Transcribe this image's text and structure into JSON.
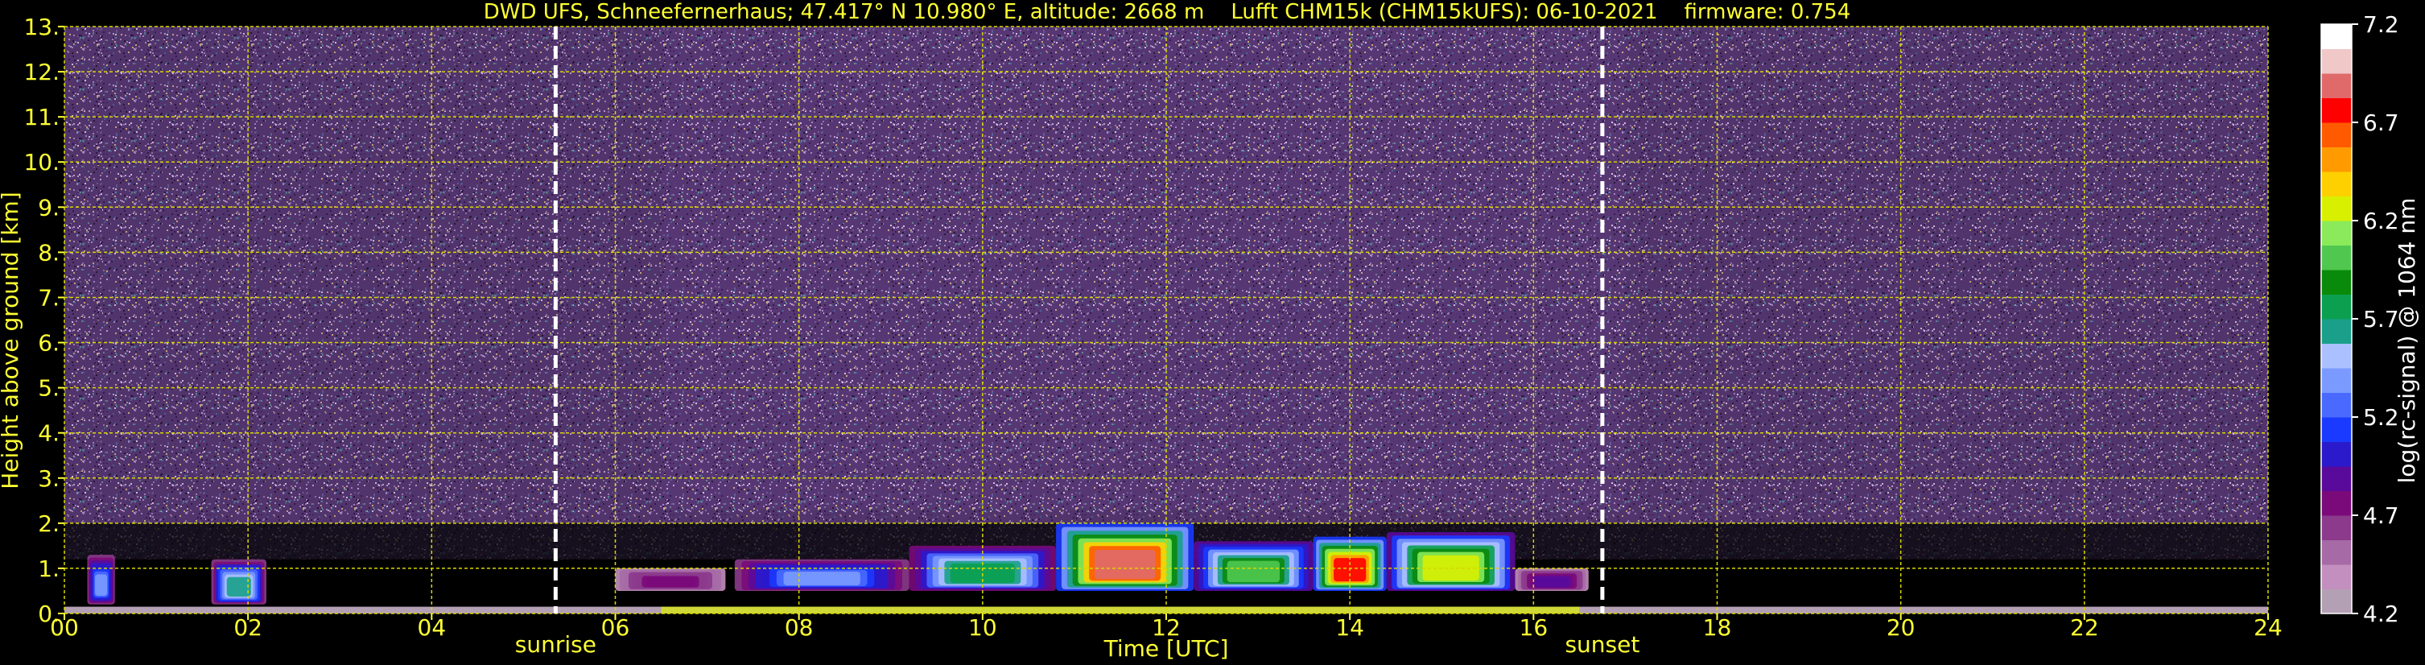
{
  "chart_data": {
    "type": "heatmap",
    "title": "DWD UFS, Schneefernerhaus; 47.417° N 10.980° E, altitude: 2668 m    Lufft CHM15k (CHM15kUFS): 06-10-2021    firmware: 0.754",
    "xlabel": "Time [UTC]",
    "ylabel": "Height above ground [km]",
    "colorbar_label": "log(rc-signal) @ 1064 nm",
    "xlim": [
      0,
      24
    ],
    "ylim": [
      0,
      13
    ],
    "x_ticks": [
      "00",
      "02",
      "04",
      "06",
      "08",
      "10",
      "12",
      "14",
      "16",
      "18",
      "20",
      "22",
      "24"
    ],
    "x_tick_values": [
      0,
      2,
      4,
      6,
      8,
      10,
      12,
      14,
      16,
      18,
      20,
      22,
      24
    ],
    "y_ticks": [
      "0.",
      "1.",
      "2.",
      "3.",
      "4.",
      "5.",
      "6.",
      "7.",
      "8.",
      "9.",
      "10.",
      "11.",
      "12.",
      "13."
    ],
    "y_tick_values": [
      0,
      1,
      2,
      3,
      4,
      5,
      6,
      7,
      8,
      9,
      10,
      11,
      12,
      13
    ],
    "colorbar_range": [
      4.2,
      7.2
    ],
    "colorbar_ticks": [
      "4.2",
      "4.7",
      "5.2",
      "5.7",
      "6.2",
      "6.7",
      "7.2"
    ],
    "colorbar_tick_values": [
      4.2,
      4.7,
      5.2,
      5.7,
      6.2,
      6.7,
      7.2
    ],
    "events": [
      {
        "label": "sunrise",
        "time": 5.35
      },
      {
        "label": "sunset",
        "time": 16.75
      }
    ],
    "grid": true,
    "cloud_layers": [
      {
        "start": 0.25,
        "end": 0.55,
        "bottom": 0.2,
        "top": 1.3,
        "max_signal": 5.4
      },
      {
        "start": 1.6,
        "end": 2.2,
        "bottom": 0.2,
        "top": 1.2,
        "max_signal": 5.6
      },
      {
        "start": 6.0,
        "end": 7.2,
        "bottom": 0.5,
        "top": 1.0,
        "max_signal": 4.8
      },
      {
        "start": 7.3,
        "end": 9.2,
        "bottom": 0.5,
        "top": 1.2,
        "max_signal": 5.4
      },
      {
        "start": 9.2,
        "end": 10.8,
        "bottom": 0.5,
        "top": 1.5,
        "max_signal": 5.8
      },
      {
        "start": 10.8,
        "end": 12.3,
        "bottom": 0.5,
        "top": 2.0,
        "max_signal": 6.9
      },
      {
        "start": 12.3,
        "end": 13.6,
        "bottom": 0.5,
        "top": 1.6,
        "max_signal": 6.0
      },
      {
        "start": 13.6,
        "end": 14.4,
        "bottom": 0.5,
        "top": 1.7,
        "max_signal": 6.8
      },
      {
        "start": 14.4,
        "end": 15.8,
        "bottom": 0.5,
        "top": 1.8,
        "max_signal": 6.3
      },
      {
        "start": 15.8,
        "end": 16.6,
        "bottom": 0.5,
        "top": 1.0,
        "max_signal": 4.9
      }
    ],
    "colors": {
      "title": "#ffff33",
      "axis_text": "#ffff33",
      "grid": "#d8d800",
      "event_line": "#ffffff",
      "colorbar_text": "#ffffff",
      "background": "#000000",
      "colormap": [
        "#b4a0b4",
        "#c38fbf",
        "#a66aa6",
        "#8c3a8c",
        "#7a0a7a",
        "#5a0a9a",
        "#2a1acc",
        "#1a3aff",
        "#4a6aff",
        "#7a9aff",
        "#aac0ff",
        "#1aa08a",
        "#0aa050",
        "#0a8a0a",
        "#50c850",
        "#8aea5a",
        "#d8f000",
        "#ffd000",
        "#ff9a00",
        "#ff5a00",
        "#ff0000",
        "#e06a6a",
        "#f0c8c8",
        "#ffffff"
      ]
    }
  }
}
